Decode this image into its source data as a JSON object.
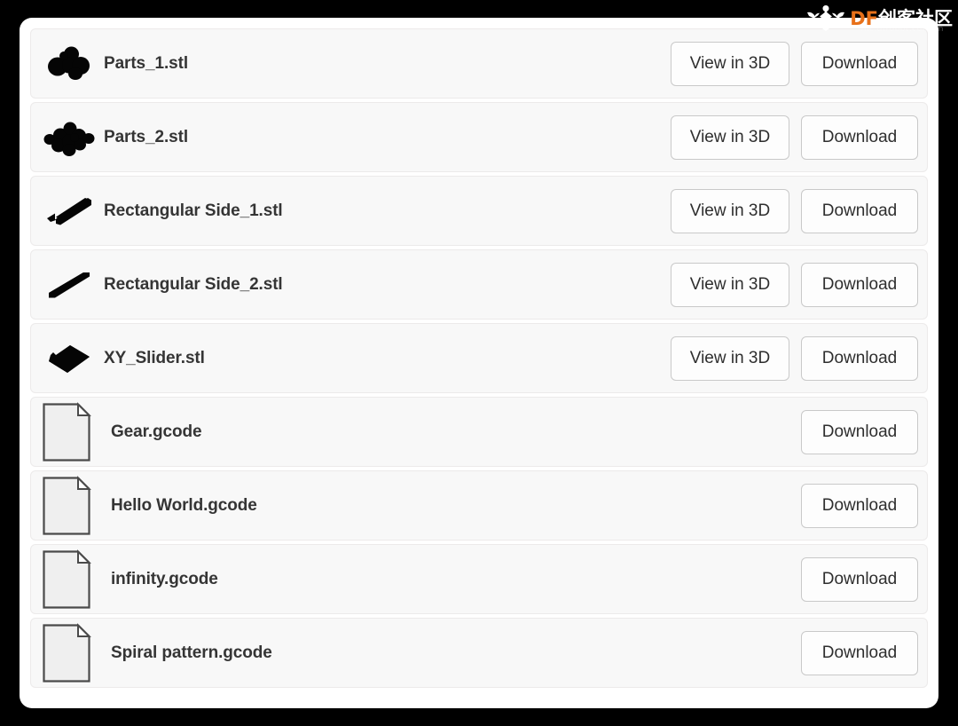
{
  "watermark": {
    "brand_prefix": "DF",
    "brand_suffix": "创客社区",
    "url": "mc.dfrobot.com.cn",
    "brand_color": "#E8711A",
    "logo_icon": "dfrobot-mascot-icon"
  },
  "buttons": {
    "view_in_3d": "View in 3D",
    "download": "Download"
  },
  "files": [
    {
      "name": "Parts_1.stl",
      "type": "stl",
      "icon": "stl-parts-cluster-icon",
      "actions": [
        "view_in_3d",
        "download"
      ]
    },
    {
      "name": "Parts_2.stl",
      "type": "stl",
      "icon": "stl-parts-cluster-large-icon",
      "actions": [
        "view_in_3d",
        "download"
      ]
    },
    {
      "name": "Rectangular Side_1.stl",
      "type": "stl",
      "icon": "stl-rectangular-bar-icon",
      "actions": [
        "view_in_3d",
        "download"
      ]
    },
    {
      "name": "Rectangular Side_2.stl",
      "type": "stl",
      "icon": "stl-rectangular-slab-icon",
      "actions": [
        "view_in_3d",
        "download"
      ]
    },
    {
      "name": "XY_Slider.stl",
      "type": "stl",
      "icon": "stl-plate-icon",
      "actions": [
        "view_in_3d",
        "download"
      ]
    },
    {
      "name": "Gear.gcode",
      "type": "gcode",
      "icon": "document-page-icon",
      "actions": [
        "download"
      ]
    },
    {
      "name": "Hello World.gcode",
      "type": "gcode",
      "icon": "document-page-icon",
      "actions": [
        "download"
      ]
    },
    {
      "name": "infinity.gcode",
      "type": "gcode",
      "icon": "document-page-icon",
      "actions": [
        "download"
      ]
    },
    {
      "name": "Spiral pattern.gcode",
      "type": "gcode",
      "icon": "document-page-icon",
      "actions": [
        "download"
      ]
    }
  ],
  "colors": {
    "page_background": "#000000",
    "card_background": "#FFFFFF",
    "row_background": "#F8F8F8",
    "row_border": "#ECEAEA",
    "button_border": "#C9C9C9",
    "text": "#353535",
    "icon_fill": "#000000"
  }
}
